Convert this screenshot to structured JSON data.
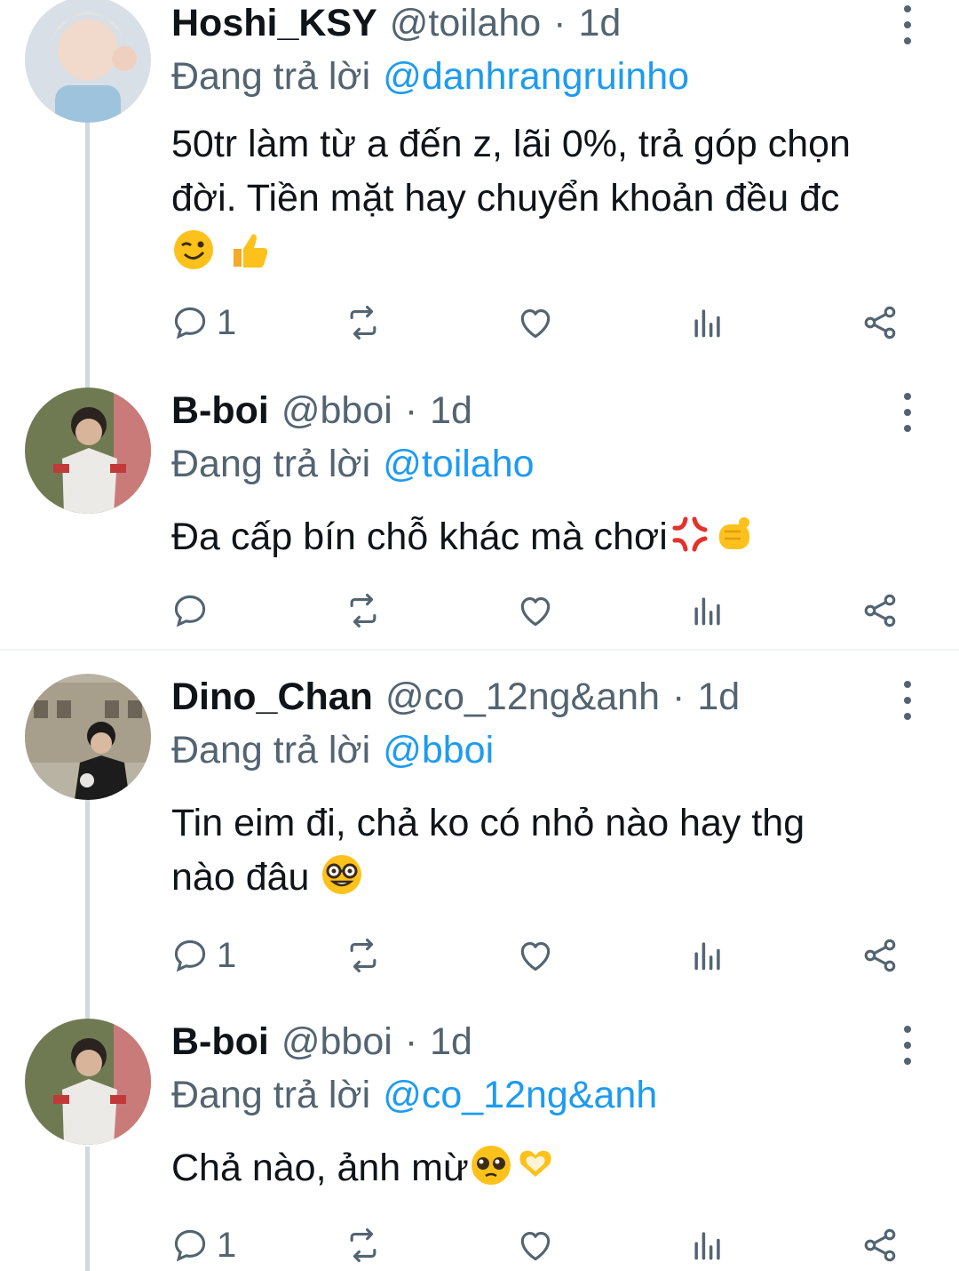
{
  "tweets": [
    {
      "name": "Hoshi_KSY",
      "handle": "@toilaho",
      "separator": "·",
      "time": "1d",
      "reply_label": "Đang trả lời",
      "reply_to": "@danhrangruinho",
      "text_lines": [
        "50tr làm từ a đến z, lãi 0%, trả góp chọn",
        "đời. Tiền mặt hay chuyển khoản đều đc",
        ""
      ],
      "emojis": [
        "winking-face-emoji",
        "thumbs-up-emoji"
      ],
      "reply_count": "1"
    },
    {
      "name": "B-boi",
      "handle": "@bboi",
      "separator": "·",
      "time": "1d",
      "reply_label": "Đang trả lời",
      "reply_to": "@toilaho",
      "text_lines": [
        "Đa cấp bín chỗ khác mà chơi"
      ],
      "emojis": [
        "anger-symbol-emoji",
        "pointing-fist-emoji"
      ],
      "reply_count": ""
    },
    {
      "name": "Dino_Chan",
      "handle": "@co_12ng&anh",
      "separator": "·",
      "time": "1d",
      "reply_label": "Đang trả lời",
      "reply_to": "@bboi",
      "text_lines": [
        "Tin eim đi, chả ko có nhỏ nào hay thg",
        "nào đâu "
      ],
      "emojis": [
        "nerd-face-emoji"
      ],
      "reply_count": "1"
    },
    {
      "name": "B-boi",
      "handle": "@bboi",
      "separator": "·",
      "time": "1d",
      "reply_label": "Đang trả lời",
      "reply_to": "@co_12ng&anh",
      "text_lines": [
        "Chả nào, ảnh mừ"
      ],
      "emojis": [
        "pleading-face-emoji",
        "heart-hands-emoji"
      ],
      "reply_count": "1"
    }
  ],
  "icons": {
    "reply": "reply-icon",
    "retweet": "retweet-icon",
    "like": "heart-icon",
    "views": "views-icon",
    "share": "share-icon",
    "more": "more-options-icon"
  },
  "colors": {
    "mention": "#1d9bf0",
    "secondary": "#536471",
    "thread_line": "#cfd9de"
  }
}
